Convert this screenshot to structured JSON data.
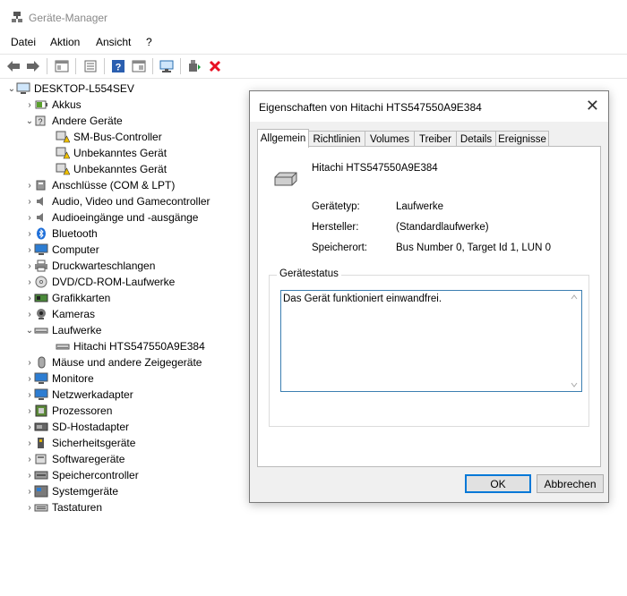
{
  "window": {
    "title": "Geräte-Manager"
  },
  "menu": [
    "Datei",
    "Aktion",
    "Ansicht",
    "?"
  ],
  "tree": {
    "root": "DESKTOP-L554SEV",
    "nodes": [
      {
        "label": "Akkus"
      },
      {
        "label": "Andere Geräte"
      },
      {
        "label": "SM-Bus-Controller"
      },
      {
        "label": "Unbekanntes Gerät"
      },
      {
        "label": "Unbekanntes Gerät"
      },
      {
        "label": "Anschlüsse (COM & LPT)"
      },
      {
        "label": "Audio, Video und Gamecontroller"
      },
      {
        "label": "Audioeingänge und -ausgänge"
      },
      {
        "label": "Bluetooth"
      },
      {
        "label": "Computer"
      },
      {
        "label": "Druckwarteschlangen"
      },
      {
        "label": "DVD/CD-ROM-Laufwerke"
      },
      {
        "label": "Grafikkarten"
      },
      {
        "label": "Kameras"
      },
      {
        "label": "Laufwerke"
      },
      {
        "label": "Hitachi HTS547550A9E384"
      },
      {
        "label": "Mäuse und andere Zeigegeräte"
      },
      {
        "label": "Monitore"
      },
      {
        "label": "Netzwerkadapter"
      },
      {
        "label": "Prozessoren"
      },
      {
        "label": "SD-Hostadapter"
      },
      {
        "label": "Sicherheitsgeräte"
      },
      {
        "label": "Softwaregeräte"
      },
      {
        "label": "Speichercontroller"
      },
      {
        "label": "Systemgeräte"
      },
      {
        "label": "Tastaturen"
      }
    ]
  },
  "dialog": {
    "title": "Eigenschaften von Hitachi HTS547550A9E384",
    "tabs": [
      "Allgemein",
      "Richtlinien",
      "Volumes",
      "Treiber",
      "Details",
      "Ereignisse"
    ],
    "device_name": "Hitachi HTS547550A9E384",
    "props": [
      {
        "label": "Gerätetyp:",
        "value": "Laufwerke"
      },
      {
        "label": "Hersteller:",
        "value": "(Standardlaufwerke)"
      },
      {
        "label": "Speicherort:",
        "value": "Bus Number 0, Target Id 1, LUN 0"
      }
    ],
    "status_group": "Gerätestatus",
    "status_text": "Das Gerät funktioniert einwandfrei.",
    "ok": "OK",
    "cancel": "Abbrechen"
  },
  "colors": {
    "accent": "#0078d7",
    "warning": "#f2c200",
    "delete": "#e81123"
  }
}
